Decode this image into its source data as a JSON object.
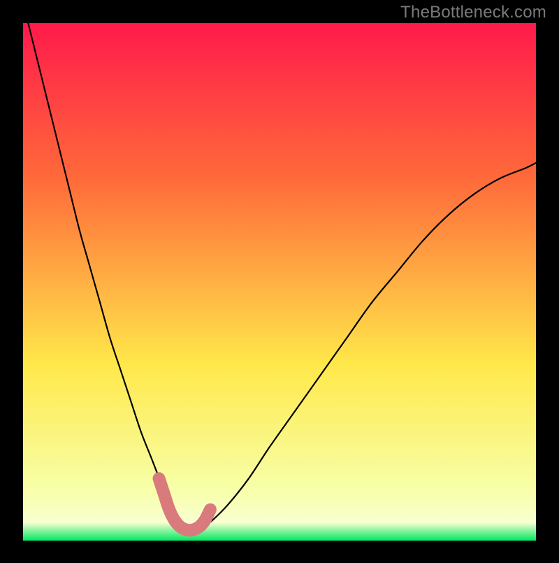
{
  "watermark": "TheBottleneck.com",
  "chart_data": {
    "type": "line",
    "title": "",
    "xlabel": "",
    "ylabel": "",
    "xlim": [
      0,
      100
    ],
    "ylim": [
      0,
      100
    ],
    "grid": false,
    "legend": false,
    "background_gradient": {
      "top_color": "#ff1a4b",
      "mid_color": "#ffe84a",
      "bottom_color": "#00e763"
    },
    "series": [
      {
        "name": "bottleneck-curve",
        "x": [
          1,
          3,
          5,
          7,
          9,
          11,
          13,
          15,
          17,
          19,
          21,
          23,
          25,
          27,
          29,
          30,
          31,
          32,
          33,
          34,
          35,
          37,
          40,
          44,
          48,
          53,
          58,
          63,
          68,
          73,
          78,
          83,
          88,
          93,
          98,
          100
        ],
        "y": [
          100,
          92,
          84,
          76,
          68,
          60,
          53,
          46,
          39,
          33,
          27,
          21,
          16,
          11,
          7,
          5,
          3.5,
          2.5,
          2,
          2,
          2.5,
          4,
          7,
          12,
          18,
          25,
          32,
          39,
          46,
          52,
          58,
          63,
          67,
          70,
          72,
          73
        ]
      },
      {
        "name": "highlight-band",
        "style": "thick-pink",
        "x": [
          26.5,
          27.5,
          28.5,
          29.5,
          30.5,
          31.5,
          32.5,
          33.5,
          34.5,
          35.5,
          36.5
        ],
        "y": [
          12,
          9,
          6,
          4,
          2.8,
          2.2,
          2,
          2.2,
          2.8,
          4,
          6
        ]
      }
    ],
    "annotations": []
  }
}
